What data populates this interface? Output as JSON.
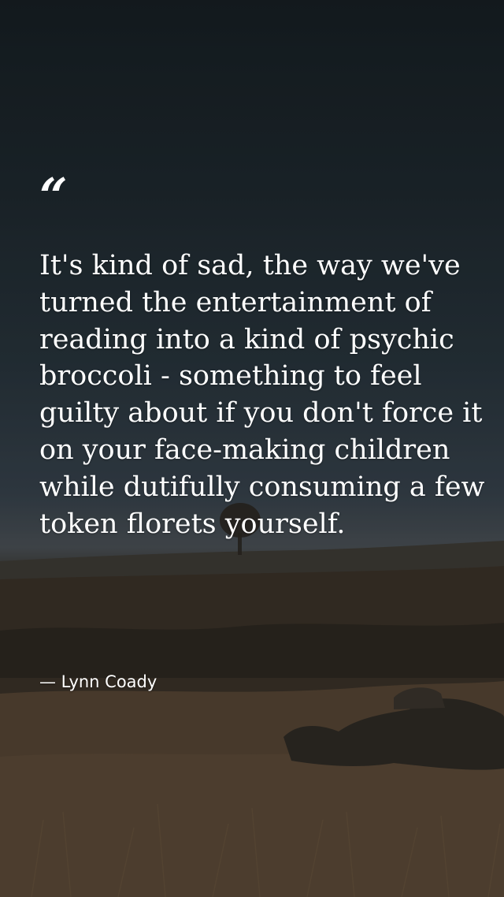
{
  "quote": {
    "mark": "“",
    "text": "It's kind of sad, the way we've turned the entertainment of reading into a kind of psychic broccoli - something to feel guilty about if you don't force it on your face-making children while dutifully consuming a few token florets yourself.",
    "author": "— Lynn Coady"
  },
  "background": {
    "subject": "grassy hillside landscape under a dark sky",
    "sky_color": "#1d262c",
    "grass_color": "#5a4937"
  }
}
